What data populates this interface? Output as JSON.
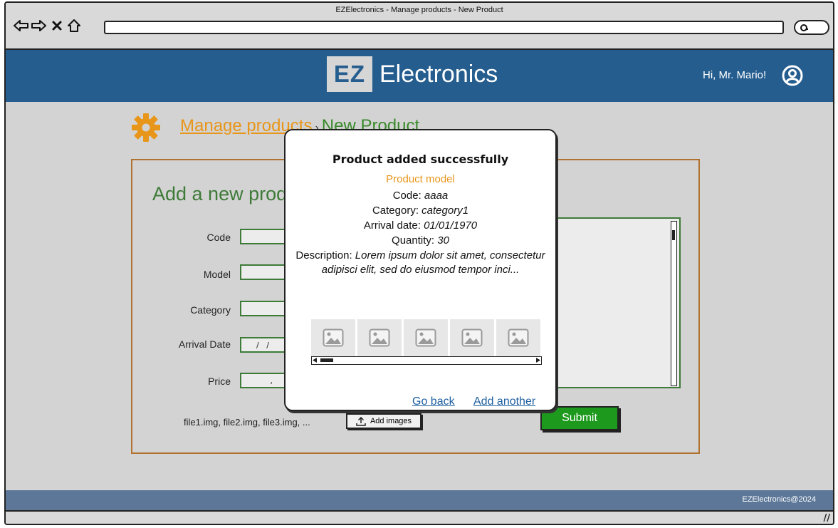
{
  "window": {
    "title": "EZElectronics - Manage products - New Product"
  },
  "browser": {
    "back_icon": "arrow-left-icon",
    "forward_icon": "arrow-right-icon",
    "close_icon": "x-icon",
    "home_icon": "home-icon",
    "address": "",
    "search_icon": "search-icon"
  },
  "header": {
    "logo_badge": "EZ",
    "logo_text": "Electronics",
    "greeting": "Hi, Mr. Mario!",
    "user_icon": "user-circle-icon"
  },
  "breadcrumb": {
    "icon": "gear-icon",
    "parent": "Manage products",
    "separator": "›",
    "current": "New Product"
  },
  "form": {
    "title": "Add a new product",
    "fields": {
      "code": {
        "label": "Code",
        "value": ""
      },
      "model": {
        "label": "Model",
        "value": ""
      },
      "category": {
        "label": "Category",
        "value": ""
      },
      "arrival_date": {
        "label": "Arrival Date",
        "value": "  /   /"
      },
      "price": {
        "label": "Price",
        "value": "   ,"
      }
    },
    "files_text": "file1.img, file2.img, file3.img, ...",
    "add_images_label": "Add images",
    "submit_label": "Submit"
  },
  "modal": {
    "title": "Product added successfully",
    "model": "Product model",
    "code_label": "Code: ",
    "code": "aaaa",
    "category_label": "Category: ",
    "category": "category1",
    "arrival_label": "Arrival date: ",
    "arrival": "01/01/1970",
    "quantity_label": "Quantity: ",
    "quantity": "30",
    "description_label": "Description: ",
    "description": "Lorem ipsum dolor sit amet, consectetur adipisci elit, sed do eiusmod tempor inci...",
    "image_count": 5,
    "go_back": "Go back",
    "add_another": "Add another"
  },
  "footer": {
    "text": "EZElectronics@2024"
  },
  "colors": {
    "header_bg": "#255d8e",
    "accent_orange": "#e8961a",
    "accent_green": "#3e7a38",
    "submit_green": "#1d9a1d",
    "link_blue": "#1f5fa0",
    "footer_bg": "#5c7798"
  }
}
